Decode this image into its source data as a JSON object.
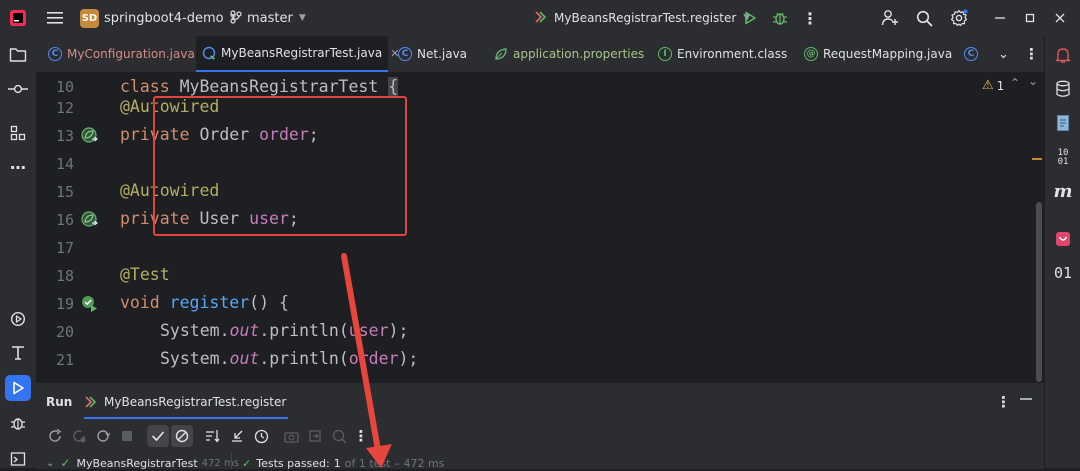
{
  "titlebar": {
    "project_badge": "SD",
    "project_name": "springboot4-demo",
    "branch": "master",
    "run_config": "MyBeansRegistrarTest.register"
  },
  "tabs": [
    {
      "label": "MyConfiguration.java",
      "icon": "C"
    },
    {
      "label": "MyBeansRegistrarTest.java",
      "icon": "C",
      "active": true
    },
    {
      "label": "Net.java",
      "icon": "C"
    },
    {
      "label": "application.properties",
      "icon": "leaf"
    },
    {
      "label": "Environment.class",
      "icon": "I"
    },
    {
      "label": "RequestMapping.java",
      "icon": "@"
    }
  ],
  "editor": {
    "warning_count": "1",
    "sticky_line": {
      "num": "10",
      "kw": "class",
      "name": " MyBeansRegistrarTest ",
      "brace": "{"
    },
    "lines": [
      {
        "num": "12",
        "ann": "@Autowired"
      },
      {
        "num": "13",
        "kw": "private",
        "type": " Order ",
        "field": "order",
        "end": ";"
      },
      {
        "num": "14"
      },
      {
        "num": "15",
        "ann": "@Autowired"
      },
      {
        "num": "16",
        "kw": "private",
        "type": " User ",
        "field": "user",
        "end": ";"
      },
      {
        "num": "17"
      },
      {
        "num": "18",
        "ann": "@Test"
      },
      {
        "num": "19",
        "kw": "void",
        "fn": " register",
        "rest": "() {"
      },
      {
        "num": "20",
        "pre": "System.",
        "ital": "out",
        "mid": ".println(",
        "arg": "user",
        "end": ");"
      },
      {
        "num": "21",
        "pre": "System.",
        "ital": "out",
        "mid": ".println(",
        "arg": "order",
        "end": ");"
      }
    ]
  },
  "run": {
    "label": "Run",
    "tab_label": "MyBeansRegistrarTest.register",
    "tree_item": "MyBeansRegistrarTest",
    "tree_time": "472 ms",
    "status_prefix": "Tests passed:",
    "status_count": "1",
    "status_suffix": "of 1 test",
    "status_time": "– 472 ms"
  },
  "colors": {
    "accent": "#3574f0",
    "highlight_box": "#e0453f",
    "arrow": "#e8453c"
  }
}
